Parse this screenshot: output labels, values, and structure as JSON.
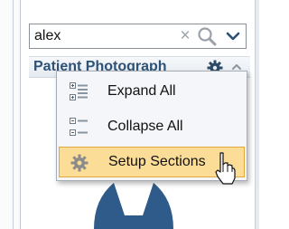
{
  "search": {
    "value": "alex",
    "clear_glyph": "×"
  },
  "section": {
    "title": "Patient Photograph"
  },
  "menu": {
    "items": [
      {
        "label": "Expand All",
        "icon": "expand-all-icon"
      },
      {
        "label": "Collapse All",
        "icon": "collapse-all-icon"
      },
      {
        "label": "Setup Sections",
        "icon": "gear-icon",
        "highlighted": true
      }
    ]
  },
  "colors": {
    "section_title": "#2d5276",
    "highlight_fill": "#fbdd97",
    "highlight_border": "#e2a83a",
    "avatar": "#2f5b8a"
  }
}
